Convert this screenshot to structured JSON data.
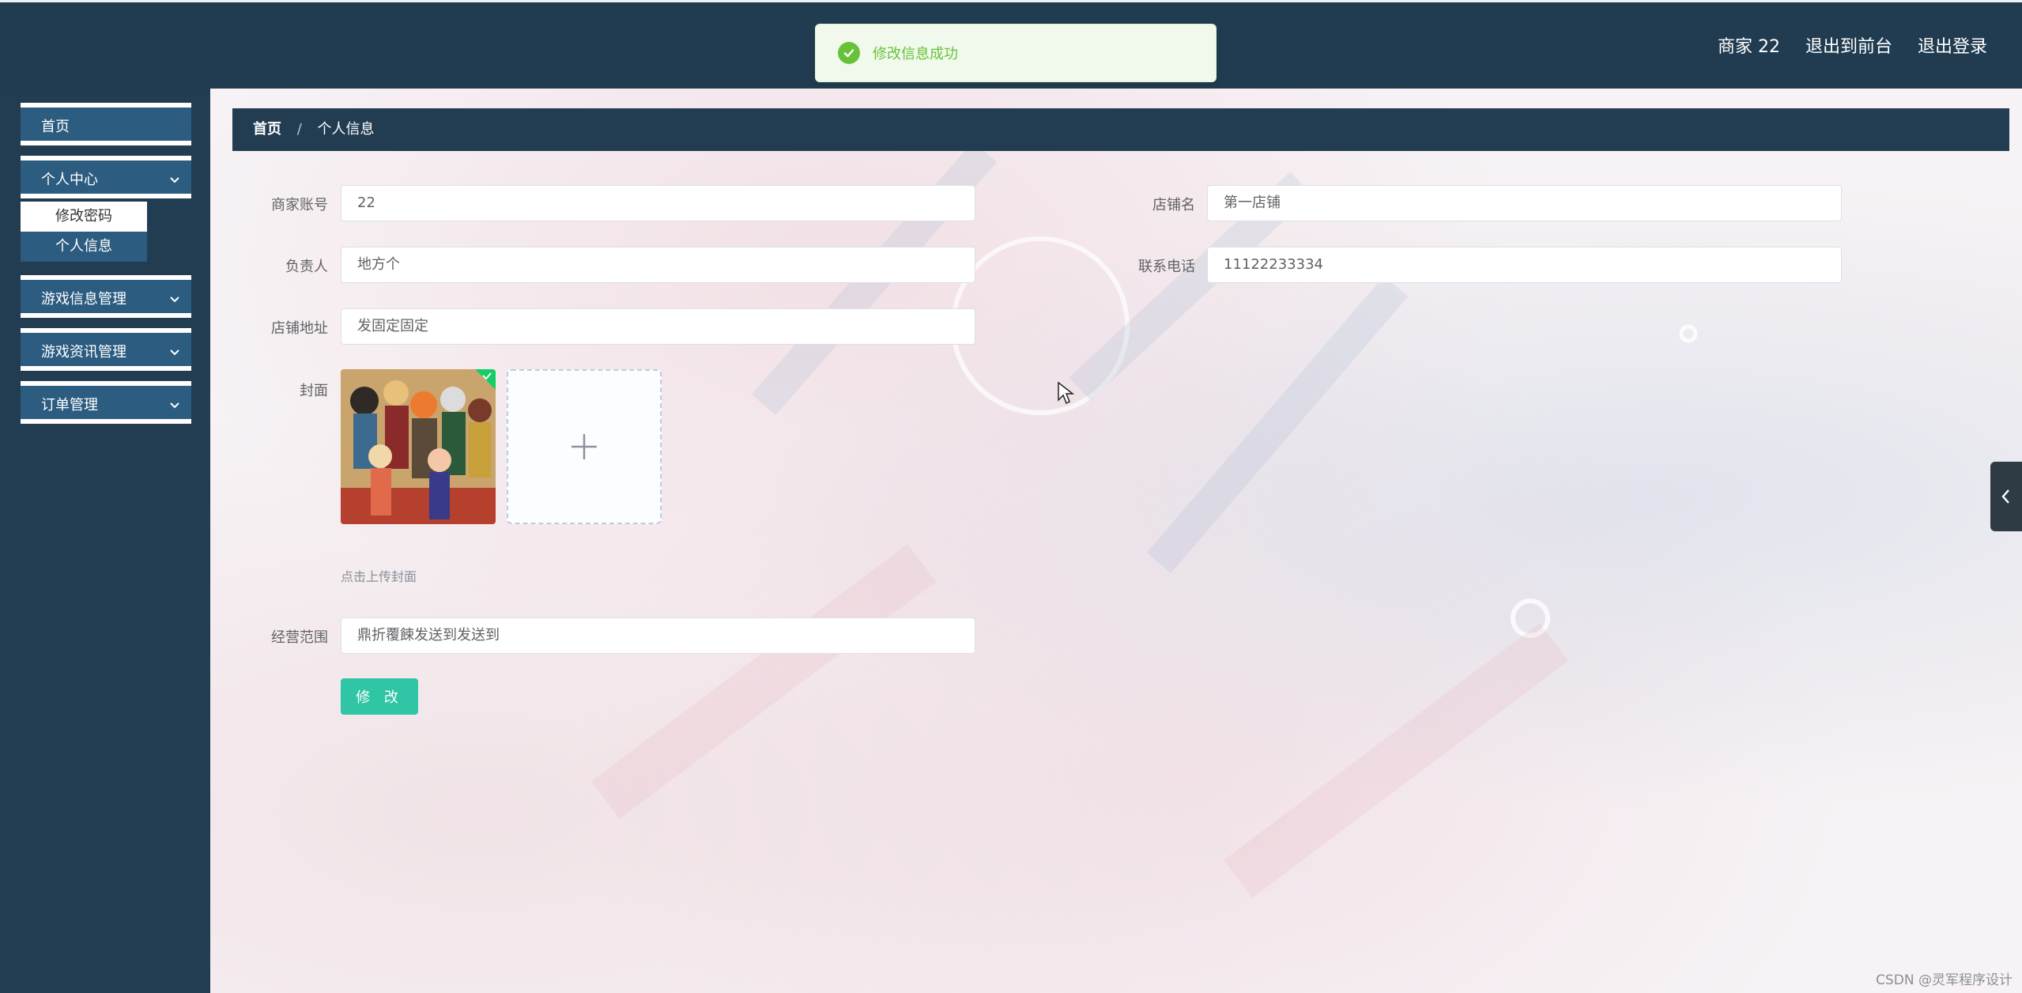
{
  "header": {
    "user_label": "商家 22",
    "exit_front_label": "退出到前台",
    "logout_label": "退出登录"
  },
  "toast": {
    "message": "修改信息成功"
  },
  "sidebar": {
    "items": [
      {
        "label": "首页"
      },
      {
        "label": "个人中心",
        "submenu": [
          "修改密码",
          "个人信息"
        ]
      },
      {
        "label": "游戏信息管理"
      },
      {
        "label": "游戏资讯管理"
      },
      {
        "label": "订单管理"
      }
    ]
  },
  "breadcrumb": {
    "home": "首页",
    "separator": "/",
    "current": "个人信息"
  },
  "form": {
    "account": {
      "label": "商家账号",
      "value": "22"
    },
    "shop_name": {
      "label": "店铺名",
      "value": "第一店铺"
    },
    "manager": {
      "label": "负责人",
      "value": "地方个"
    },
    "phone": {
      "label": "联系电话",
      "value": "11122233334"
    },
    "address": {
      "label": "店铺地址",
      "value": "发固定固定"
    },
    "cover": {
      "label": "封面",
      "hint": "点击上传封面"
    },
    "scope": {
      "label": "经营范围",
      "value": "鼎折覆餗发送到发送到"
    },
    "submit_label": "修 改"
  },
  "watermark": "CSDN @灵军程序设计",
  "colors": {
    "header_bg": "#213c50",
    "menu_item_bg": "#2c5c80",
    "success": "#67c23a",
    "submit_btn": "#2fc5a5"
  }
}
